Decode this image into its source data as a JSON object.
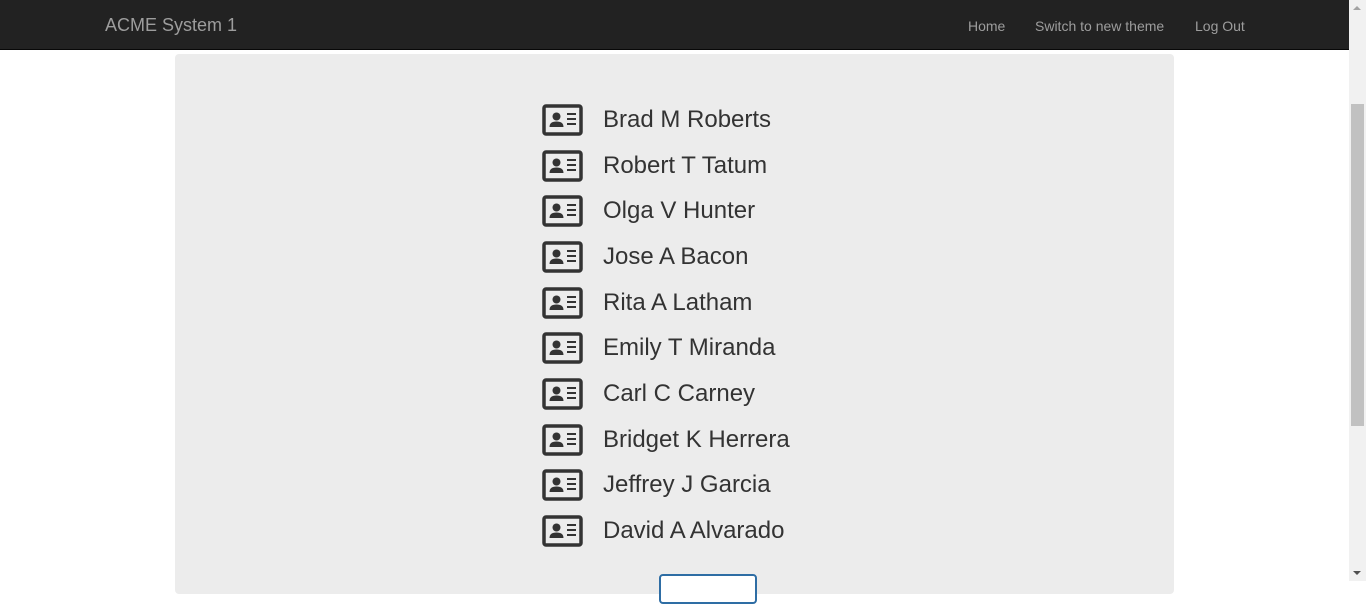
{
  "navbar": {
    "brand": "ACME System 1",
    "links": {
      "home": "Home",
      "switch_theme": "Switch to new theme",
      "logout": "Log Out"
    }
  },
  "people": [
    {
      "name": "Brad M Roberts",
      "icon": "address-card-icon"
    },
    {
      "name": "Robert T Tatum",
      "icon": "address-card-icon"
    },
    {
      "name": "Olga V Hunter",
      "icon": "address-card-icon"
    },
    {
      "name": "Jose A Bacon",
      "icon": "address-card-icon"
    },
    {
      "name": "Rita A Latham",
      "icon": "address-card-icon"
    },
    {
      "name": "Emily T Miranda",
      "icon": "address-card-icon"
    },
    {
      "name": "Carl C Carney",
      "icon": "address-card-icon"
    },
    {
      "name": "Bridget K Herrera",
      "icon": "address-card-icon"
    },
    {
      "name": "Jeffrey J Garcia",
      "icon": "address-card-icon"
    },
    {
      "name": "David A Alvarado",
      "icon": "address-card-icon"
    }
  ],
  "colors": {
    "navbar_bg": "#222222",
    "nav_text": "#9d9d9d",
    "panel_bg": "#ececec",
    "name_text": "#333333",
    "button_border": "#2e6da4"
  }
}
